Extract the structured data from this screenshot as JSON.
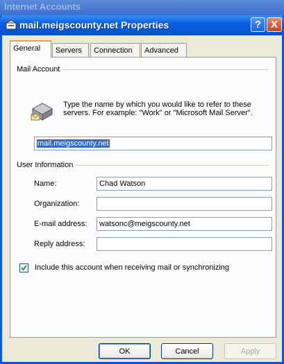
{
  "background_window": {
    "title": "Internet Accounts"
  },
  "dialog": {
    "title": "mail.meigscounty.net Properties",
    "help_glyph": "?",
    "close_glyph": "X"
  },
  "tabs": [
    {
      "label": "General",
      "active": true
    },
    {
      "label": "Servers",
      "active": false
    },
    {
      "label": "Connection",
      "active": false
    },
    {
      "label": "Advanced",
      "active": false
    }
  ],
  "mail_account": {
    "group_label": "Mail Account",
    "icon": "mail-server-icon",
    "description": "Type the name by which you would like to refer to these servers.  For example: \"Work\" or \"Microsoft Mail Server\".",
    "account_name_value": "mail.meigscounty.net"
  },
  "user_information": {
    "group_label": "User Information",
    "name_label": "Name:",
    "name_value": "Chad Watson",
    "organization_label": "Organization:",
    "organization_value": "",
    "email_label": "E-mail address:",
    "email_value": "watsonc@meigscounty.net",
    "reply_label": "Reply address:",
    "reply_value": ""
  },
  "include_account": {
    "checked": true,
    "label": "Include this account when receiving mail or synchronizing"
  },
  "buttons": {
    "ok": "OK",
    "cancel": "Cancel",
    "apply": "Apply"
  },
  "colors": {
    "title_bar": "#0a5fe0",
    "tab_highlight": "#e8a33d",
    "selection": "#316ac5"
  }
}
